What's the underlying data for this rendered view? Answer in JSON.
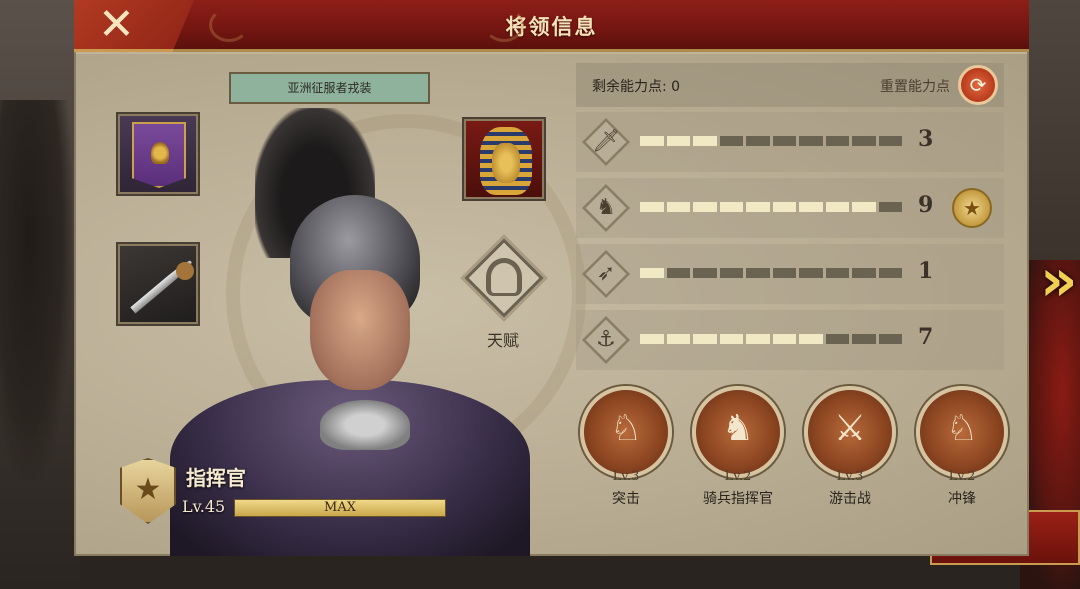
{
  "header": {
    "title": "将领信息",
    "close_icon": "close-icon"
  },
  "equipment": {
    "outfit_label": "亚洲征服者戎装",
    "banner_icon": "legion-banner-icon",
    "weapon_icon": "gladius-sword-icon",
    "accessory_icon": "pharaoh-mask-icon"
  },
  "talent": {
    "label": "天赋",
    "icon": "helmet-icon"
  },
  "commander": {
    "rank": "指挥官",
    "level": "Lv.45",
    "exp_label": "MAX",
    "exp_fraction": 1.0,
    "badge_icon": "star-shield-icon"
  },
  "stats_panel": {
    "remaining_points": "剩余能力点: 0",
    "reset_label": "重置能力点",
    "reset_icon": "refresh-icon",
    "max_segments": 10,
    "stats": [
      {
        "icon": "sword-icon",
        "value": "3",
        "filled": 3,
        "medal": false
      },
      {
        "icon": "horse-icon",
        "value": "9",
        "filled": 9,
        "medal": true,
        "medal_icon": "laurel-star-medal-icon"
      },
      {
        "icon": "bow-icon",
        "value": "1",
        "filled": 1,
        "medal": false
      },
      {
        "icon": "anchor-icon",
        "value": "7",
        "filled": 7,
        "medal": false
      }
    ]
  },
  "skills": [
    {
      "level": "Lv.3",
      "name": "突击",
      "icon": "charging-cavalry-icon"
    },
    {
      "level": "Lv.2",
      "name": "骑兵指挥官",
      "icon": "horse-head-icon"
    },
    {
      "level": "Lv.3",
      "name": "游击战",
      "icon": "skirmish-riders-icon"
    },
    {
      "level": "Lv.2",
      "name": "冲锋",
      "icon": "lancer-charge-icon"
    }
  ],
  "navigation": {
    "next_icon": "double-chevron-right-icon"
  },
  "colors": {
    "header_red": "#7a1812",
    "panel_beige": "#bfb39a",
    "bar_filled": "#f1e8c4",
    "bar_empty": "#6b6352",
    "accent_gold": "#f0cf52"
  }
}
